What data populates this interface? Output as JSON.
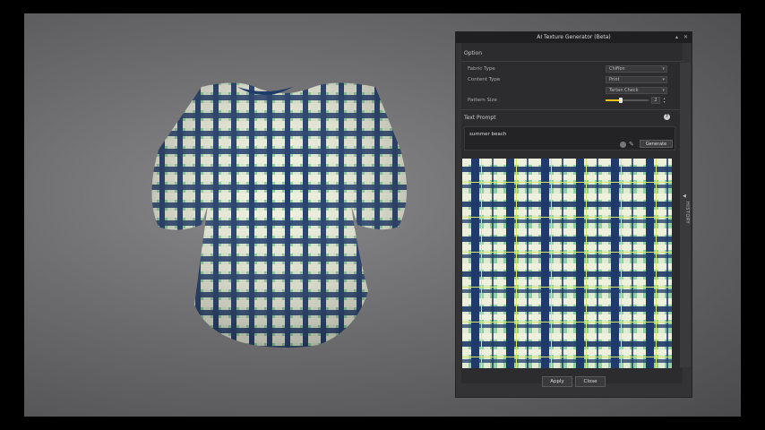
{
  "panel": {
    "title": "AI Texture Generator (Beta)",
    "titlebar_icons": [
      "pin-icon",
      "close-icon"
    ],
    "option_label": "Option",
    "rows": [
      {
        "label": "Fabric Type",
        "value": "Chiffon"
      },
      {
        "label": "Content Type",
        "value": "Print"
      },
      {
        "label": "",
        "value": "Tartan Check"
      }
    ],
    "pattern_size": {
      "label": "Pattern Size",
      "value": "2",
      "fill": 0.35
    },
    "text_prompt_label": "Text Prompt",
    "help": "?",
    "prompt": "summer beach",
    "generate_label": "Generate",
    "history_label": "HISTORY",
    "history_arrow": "◀",
    "apply_label": "Apply",
    "close_label": "Close"
  },
  "colors": {
    "navy": "#1f3a6b",
    "mint": "#8fcfa3",
    "cream": "#eef0dc",
    "lime_thread": "#d8e86a",
    "accent_slider": "#f0c21d"
  }
}
